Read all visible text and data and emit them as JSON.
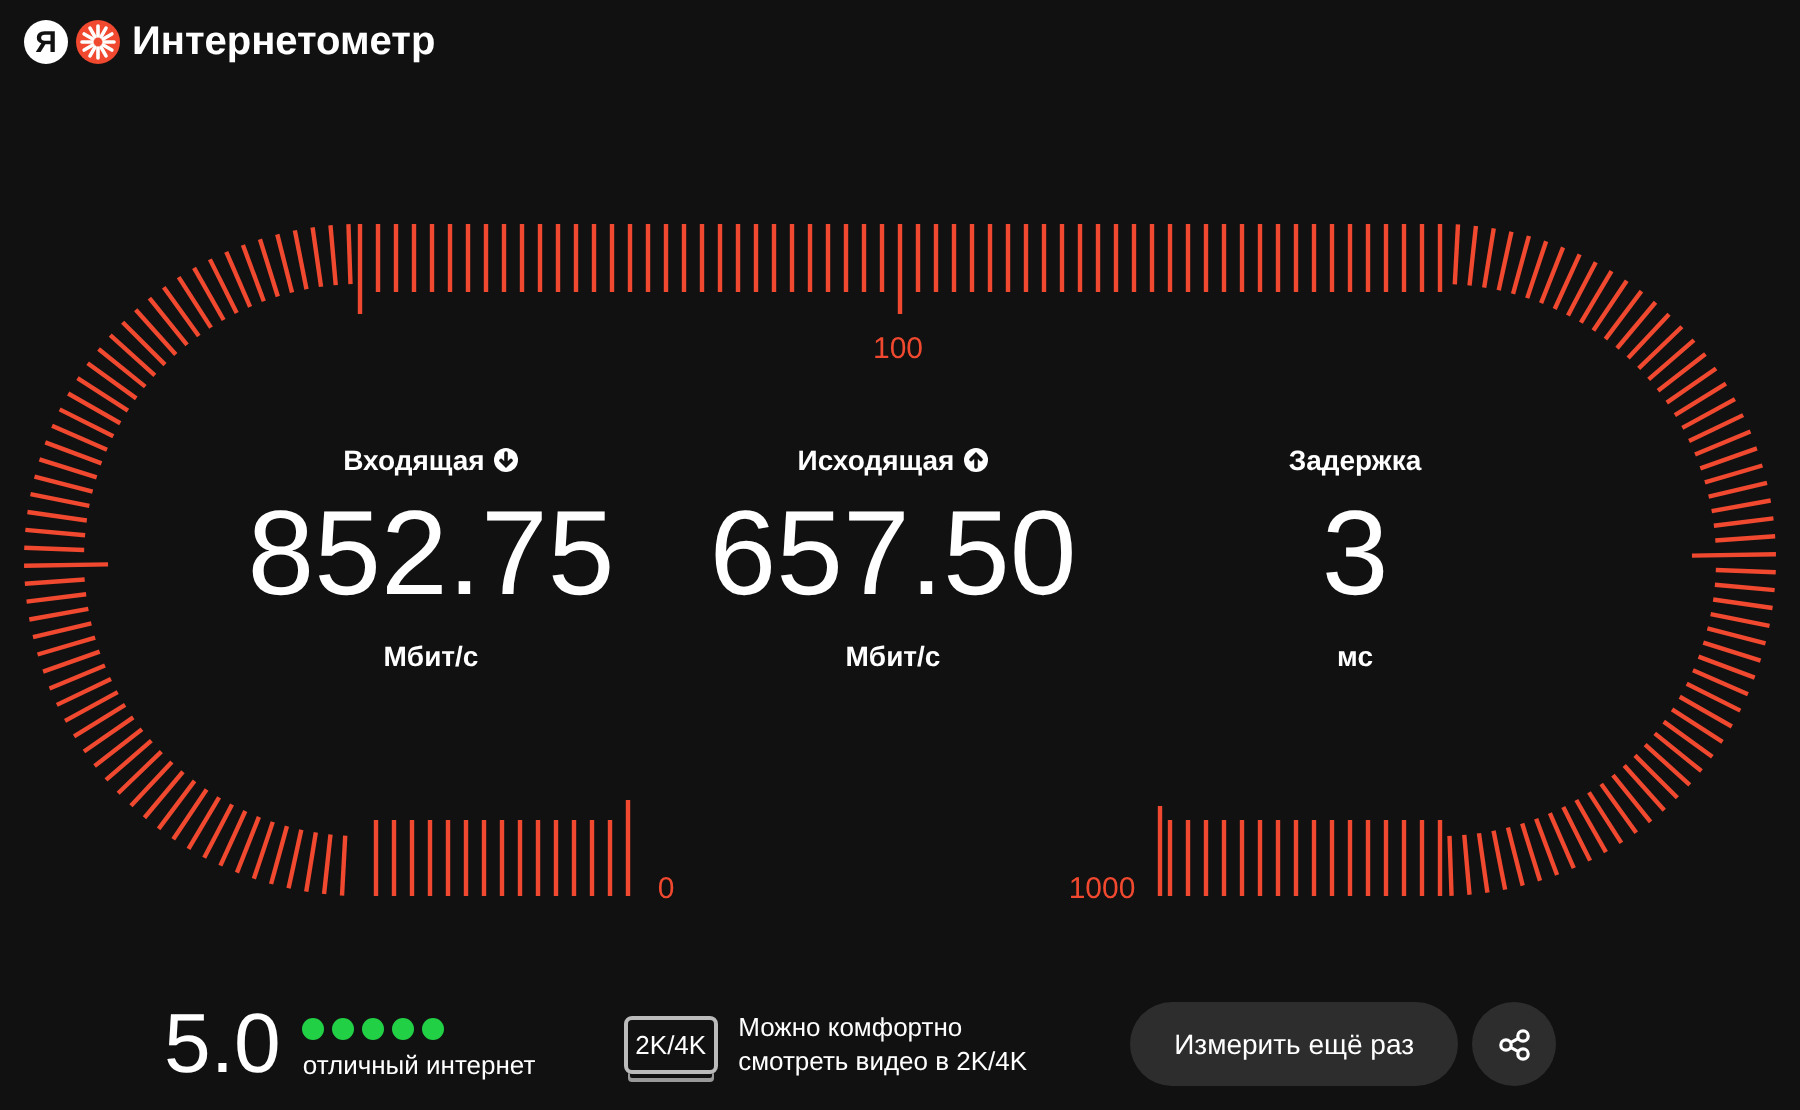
{
  "header": {
    "logo_letter": "Я",
    "title": "Интернетометр"
  },
  "gauge": {
    "top_label": "100",
    "start_label": "0",
    "end_label": "1000"
  },
  "metrics": [
    {
      "label": "Входящая",
      "kind": "download",
      "value": "852.75",
      "unit": "Мбит/с"
    },
    {
      "label": "Исходящая",
      "kind": "upload",
      "value": "657.50",
      "unit": "Мбит/с"
    },
    {
      "label": "Задержка",
      "value": "3",
      "unit": "мс"
    }
  ],
  "rating": {
    "score": "5.0",
    "stars": 5,
    "caption": "отличный интернет"
  },
  "quality": {
    "badge": "2K/4K",
    "text": "Можно комфортно смотреть видео в 2K/4K"
  },
  "actions": {
    "retry_button": "Измерить ещё раз"
  }
}
